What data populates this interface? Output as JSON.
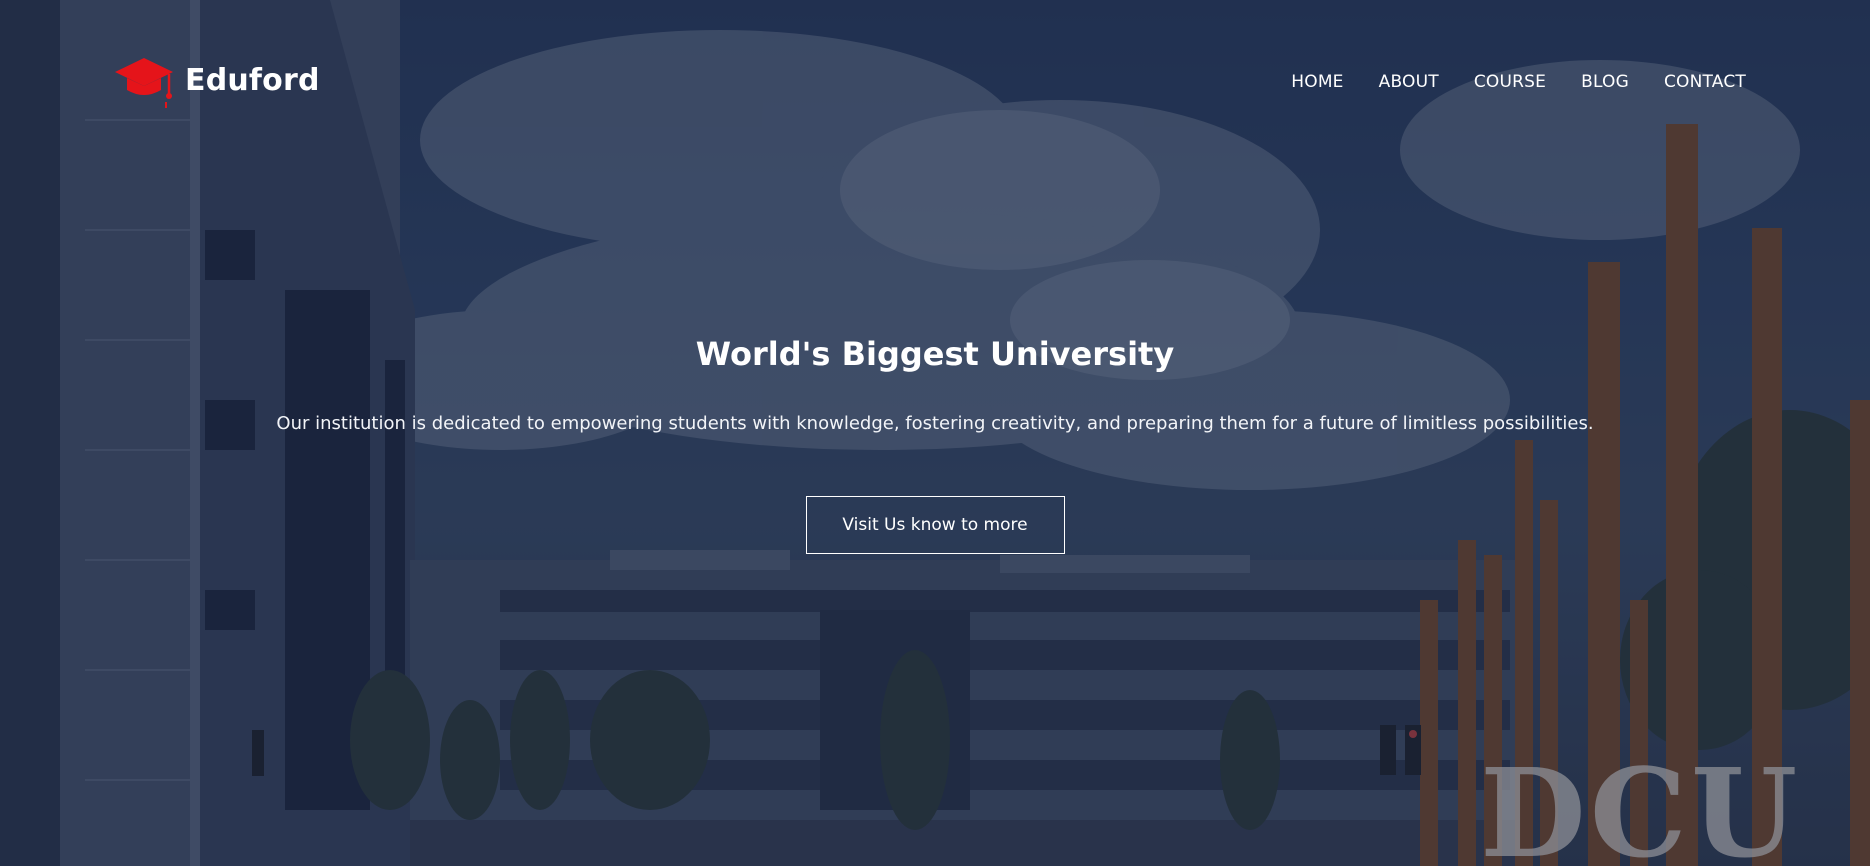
{
  "brand": {
    "name": "Eduford",
    "accent_color": "#e5141a",
    "icon": "graduation-cap-icon"
  },
  "nav": {
    "items": [
      {
        "label": "HOME"
      },
      {
        "label": "ABOUT"
      },
      {
        "label": "COURSE"
      },
      {
        "label": "BLOG"
      },
      {
        "label": "CONTACT"
      }
    ]
  },
  "hero": {
    "title": "World's Biggest University",
    "subtitle": "Our institution is dedicated to empowering students with knowledge, fostering creativity, and preparing them for a future of limitless possibilities.",
    "cta_label": "Visit Us know to more",
    "sign_text": "DCU"
  }
}
